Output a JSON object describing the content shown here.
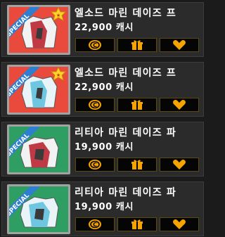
{
  "shop_items": [
    {
      "name": "엘소드 마린 데이즈 프",
      "price": "22,900 캐시",
      "badge_text": "SPECIAL",
      "has_star_badge": true,
      "background_color": "#e94a3c",
      "garment_colors": [
        "#f2f2f2",
        "#c03a45",
        "#3a3a3a"
      ],
      "buttons": {
        "buy": "cash-coin-icon",
        "gift": "gift-box-icon",
        "wishlist": "heart-icon"
      }
    },
    {
      "name": "엘소드 마린 데이즈 프",
      "price": "22,900 캐시",
      "badge_text": "SPECIAL",
      "has_star_badge": true,
      "background_color": "#e94a3c",
      "garment_colors": [
        "#e8f4f8",
        "#6ec6e0",
        "#3a3a3a"
      ],
      "buttons": {
        "buy": "cash-coin-icon",
        "gift": "gift-box-icon",
        "wishlist": "heart-icon"
      }
    },
    {
      "name": "리티아 마린 데이즈 파",
      "price": "19,900 캐시",
      "badge_text": "SPECIAL",
      "has_star_badge": false,
      "background_color": "#2f9e63",
      "garment_colors": [
        "#f2f2f2",
        "#c03a45",
        "#3a3a3a"
      ],
      "buttons": {
        "buy": "cash-coin-icon",
        "gift": "gift-box-icon",
        "wishlist": "heart-icon"
      }
    },
    {
      "name": "리티아 마린 데이즈 파",
      "price": "19,900 캐시",
      "badge_text": "SPECIAL",
      "has_star_badge": false,
      "background_color": "#2f9e63",
      "garment_colors": [
        "#e8f4f8",
        "#6ec6e0",
        "#3a3a3a"
      ],
      "buttons": {
        "buy": "cash-coin-icon",
        "gift": "gift-box-icon",
        "wishlist": "heart-icon"
      }
    }
  ],
  "colors": {
    "button_icon": "#f4a300",
    "card_background": "#2b2b2b",
    "special_ribbon": "#2f7fd0"
  }
}
